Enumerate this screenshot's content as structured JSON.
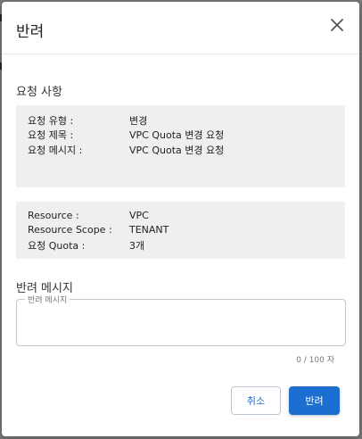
{
  "dialog": {
    "title": "반려",
    "close_icon": "close-icon"
  },
  "request": {
    "section_title": "요청 사항",
    "info": [
      {
        "label": "요청 유형 :",
        "value": "변경"
      },
      {
        "label": "요청 제목 :",
        "value": "VPC Quota 변경 요청"
      },
      {
        "label": "요청 메시지 :",
        "value": "VPC Quota 변경 요청"
      }
    ],
    "resource": [
      {
        "label": "Resource :",
        "value": "VPC"
      },
      {
        "label": "Resource Scope :",
        "value": "TENANT"
      },
      {
        "label": "요청 Quota :",
        "value": "3개"
      }
    ]
  },
  "reject": {
    "section_title": "반려 메시지",
    "field_label": "반려 메시지",
    "value": "",
    "counter": "0 / 100 자"
  },
  "buttons": {
    "cancel": "취소",
    "reject": "반려"
  }
}
